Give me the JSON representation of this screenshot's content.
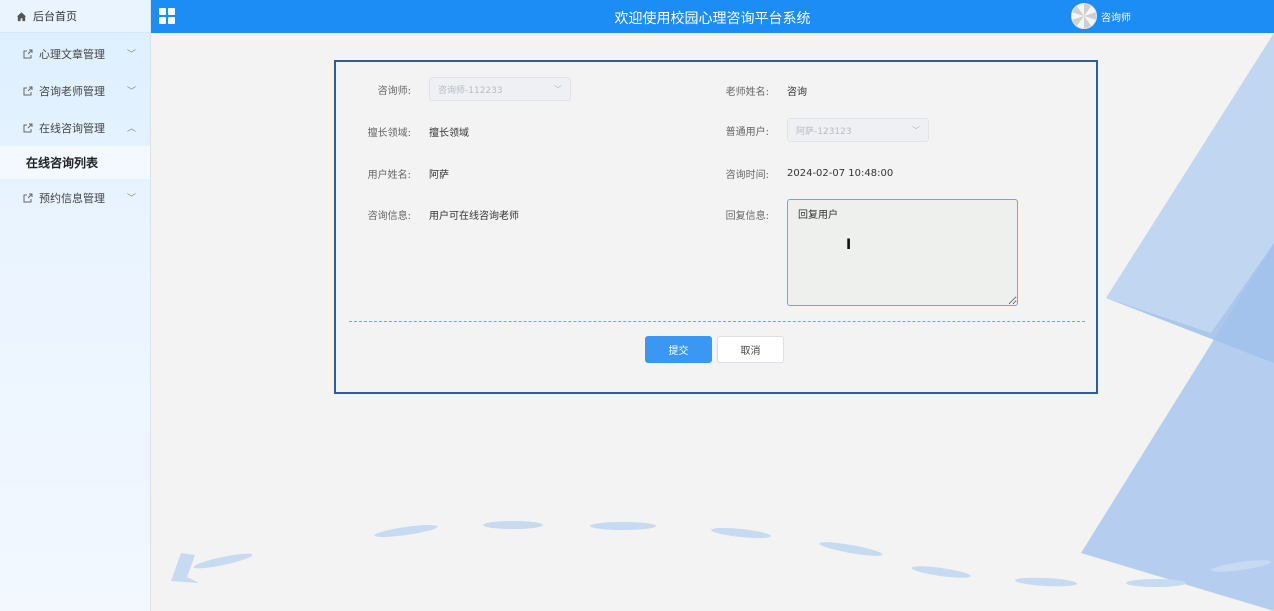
{
  "sidebar": {
    "home_label": "后台首页",
    "menus": [
      {
        "label": "心理文章管理",
        "chevron": "﹀"
      },
      {
        "label": "咨询老师管理",
        "chevron": "﹀"
      },
      {
        "label": "在线咨询管理",
        "chevron": "︿"
      },
      {
        "label": "预约信息管理",
        "chevron": "﹀"
      }
    ],
    "active_submenu": "在线咨询列表"
  },
  "header": {
    "title": "欢迎使用校园心理咨询平台系统",
    "user": "咨询师"
  },
  "form": {
    "consultant_label": "咨询师:",
    "consultant_value": "咨询师-112233",
    "teacher_name_label": "老师姓名:",
    "teacher_name_value": "咨询",
    "expertise_label": "擅长领域:",
    "expertise_value": "擅长领域",
    "regular_user_label": "普通用户:",
    "regular_user_value": "阿萨-123123",
    "user_name_label": "用户姓名:",
    "user_name_value": "阿萨",
    "consult_time_label": "咨询时间:",
    "consult_time_value": "2024-02-07 10:48:00",
    "consult_info_label": "咨询信息:",
    "consult_info_value": "用户可在线咨询老师",
    "reply_label": "回复信息:",
    "reply_value": "回复用户",
    "submit_label": "提交",
    "cancel_label": "取消"
  },
  "colors": {
    "topbar": "#1b8df5",
    "accent": "#3a97f2",
    "card_border": "#2c5f9a"
  }
}
